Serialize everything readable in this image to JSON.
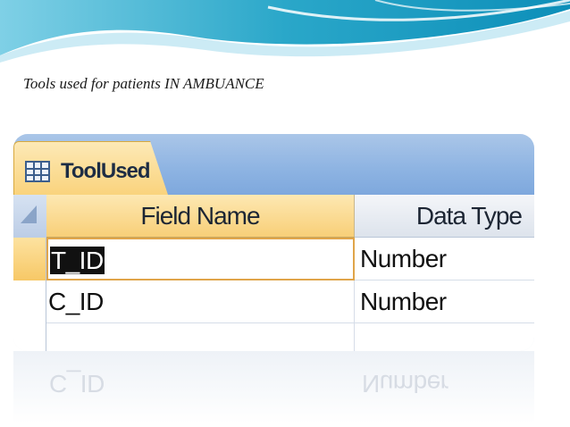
{
  "slide": {
    "caption": "Tools  used  for  patients IN AMBUANCE"
  },
  "table_window": {
    "tab_label": "ToolUsed",
    "tab_icon": "table-grid-icon",
    "columns": [
      "Field Name",
      "Data Type"
    ],
    "rows": [
      {
        "field_name": "T_ID",
        "data_type": "Number",
        "selected": true
      },
      {
        "field_name": "C_ID",
        "data_type": "Number",
        "selected": false
      }
    ],
    "reflection": {
      "field_name": "C_ID",
      "data_type": "Number"
    }
  },
  "colors": {
    "tab_gold": "#f9d27a",
    "titlebar_blue": "#8db3e2",
    "wave_teal": "#2aa7c9"
  }
}
